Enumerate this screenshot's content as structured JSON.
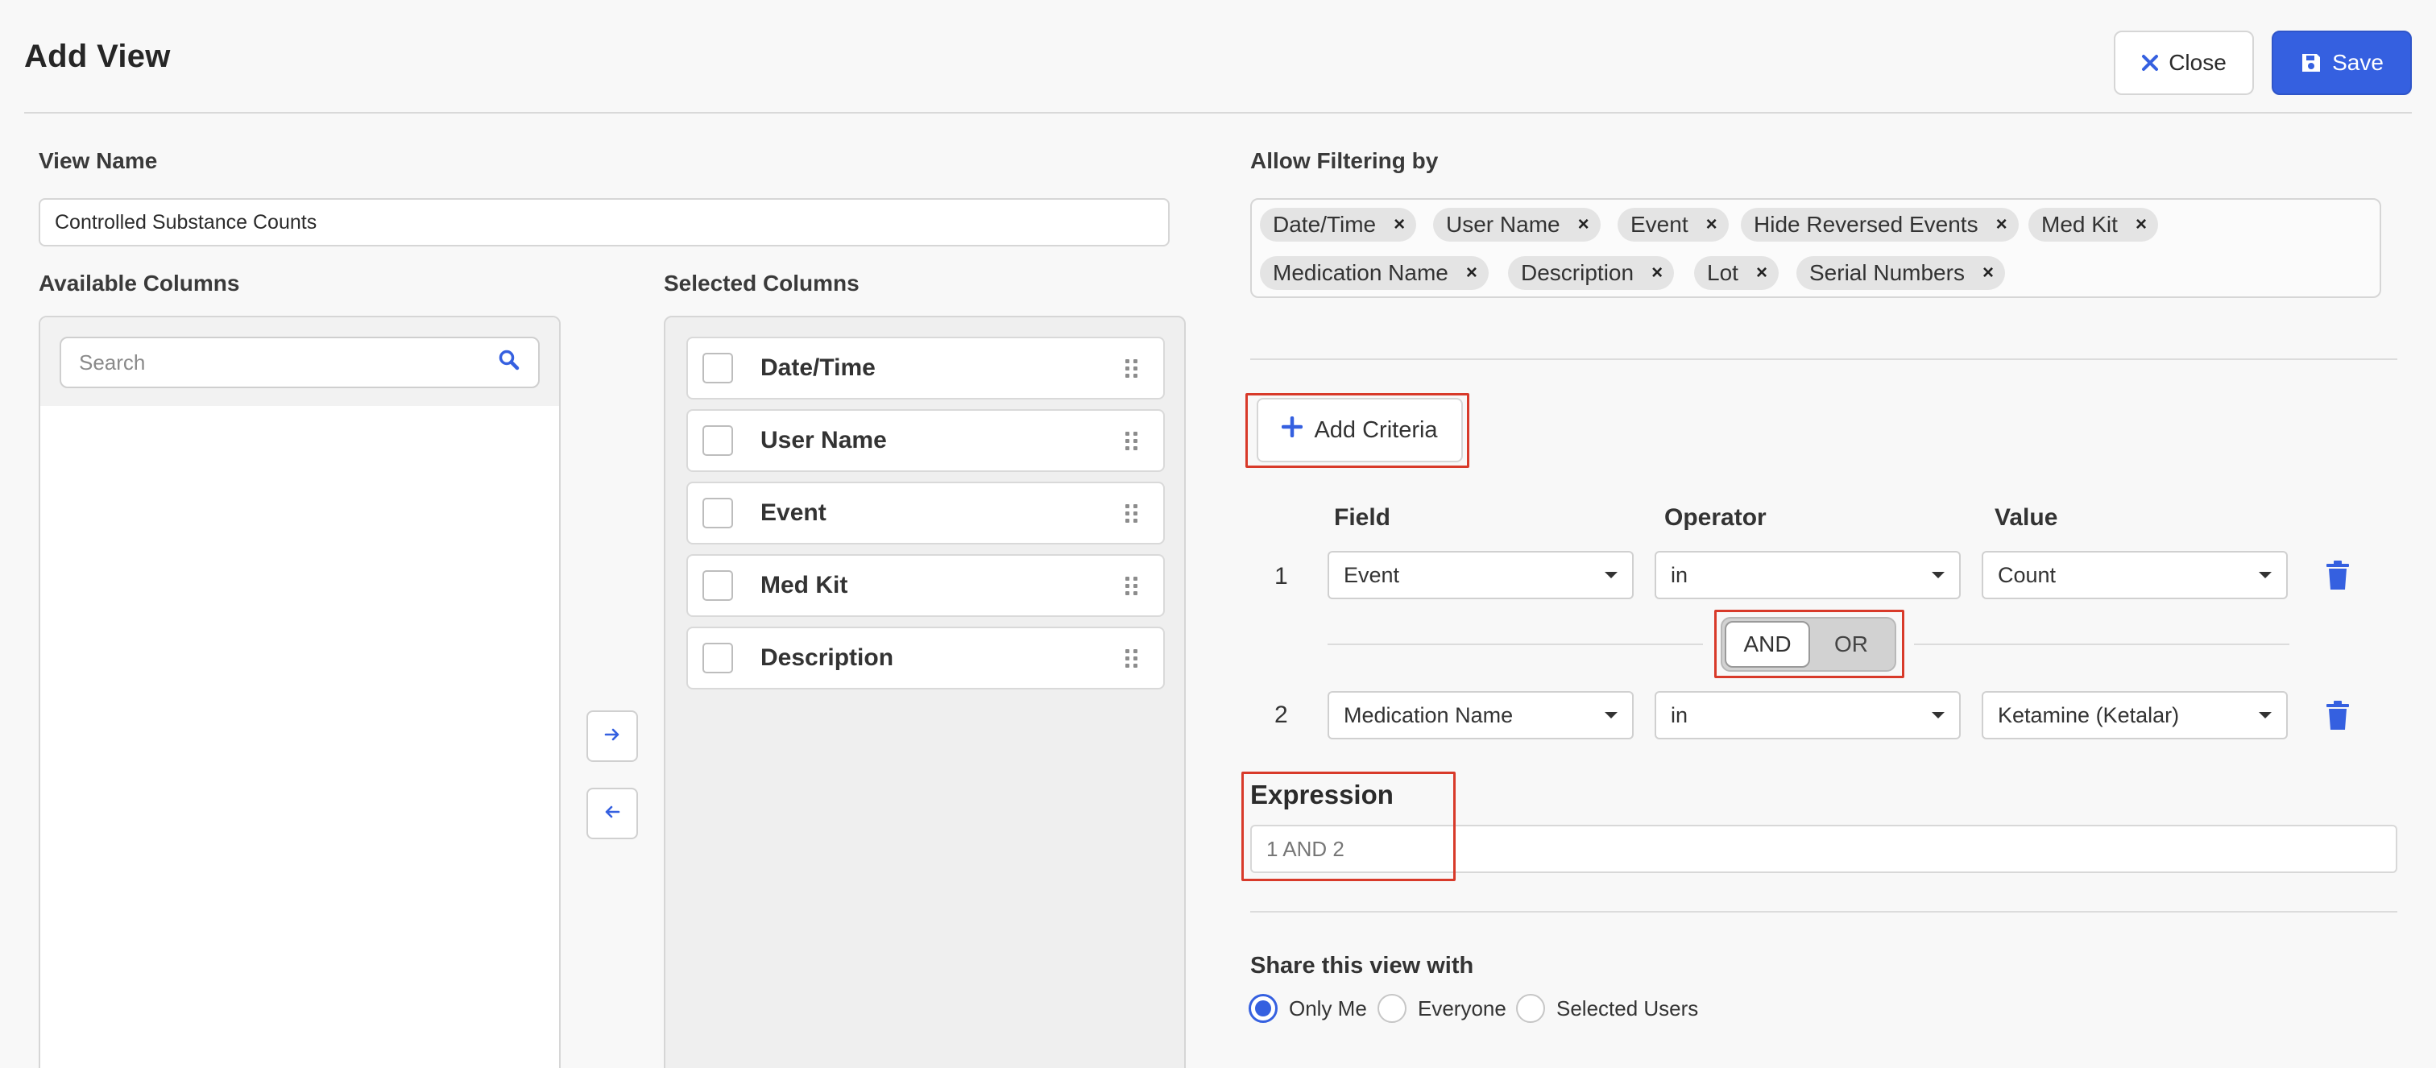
{
  "header": {
    "title": "Add View",
    "close_label": "Close",
    "save_label": "Save"
  },
  "view_name": {
    "label": "View Name",
    "value": "Controlled Substance Counts"
  },
  "available_columns": {
    "label": "Available Columns",
    "search_placeholder": "Search",
    "items": []
  },
  "selected_columns": {
    "label": "Selected Columns",
    "items": [
      {
        "label": "Date/Time"
      },
      {
        "label": "User Name"
      },
      {
        "label": "Event"
      },
      {
        "label": "Med Kit"
      },
      {
        "label": "Description"
      }
    ]
  },
  "filtering": {
    "label": "Allow Filtering by",
    "chips": [
      {
        "label": "Date/Time"
      },
      {
        "label": "User Name"
      },
      {
        "label": "Event"
      },
      {
        "label": "Hide Reversed Events"
      },
      {
        "label": "Med Kit"
      },
      {
        "label": "Medication Name"
      },
      {
        "label": "Description"
      },
      {
        "label": "Lot"
      },
      {
        "label": "Serial Numbers"
      }
    ],
    "remove_glyph": "×"
  },
  "criteria": {
    "add_label": "Add Criteria",
    "columns": {
      "field": "Field",
      "operator": "Operator",
      "value": "Value"
    },
    "rows": [
      {
        "num": "1",
        "field": "Event",
        "operator": "in",
        "value": "Count"
      },
      {
        "num": "2",
        "field": "Medication Name",
        "operator": "in",
        "value": "Ketamine (Ketalar)"
      }
    ],
    "logic": {
      "options": [
        "AND",
        "OR"
      ],
      "selected": "AND"
    }
  },
  "expression": {
    "label": "Expression",
    "value": "1 AND 2"
  },
  "share": {
    "label": "Share this view with",
    "options": [
      "Only Me",
      "Everyone",
      "Selected Users"
    ],
    "selected": "Only Me"
  },
  "colors": {
    "accent": "#3560e0",
    "highlight": "#d83a2a"
  }
}
